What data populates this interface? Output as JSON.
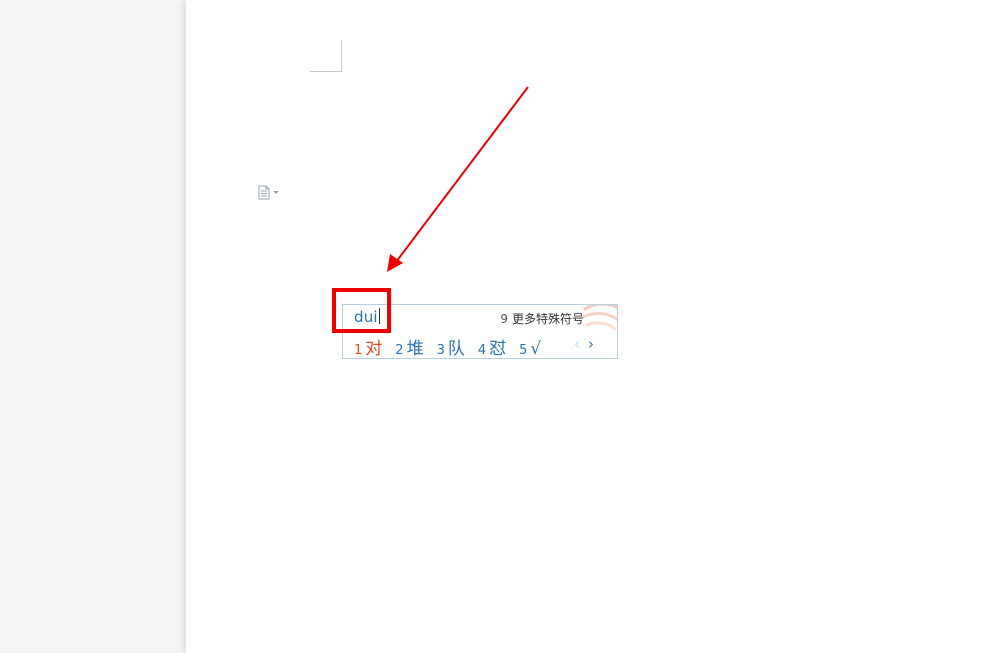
{
  "document": {
    "paragraph_icon": "document-icon",
    "paragraph_dropdown_icon": "caret-down-icon"
  },
  "ime": {
    "composition": "dui",
    "more_symbols_index": "9",
    "more_symbols_label": "更多特殊符号",
    "candidates": [
      {
        "index": "1",
        "text": "对",
        "selected": true
      },
      {
        "index": "2",
        "text": "堆",
        "selected": false
      },
      {
        "index": "3",
        "text": "队",
        "selected": false
      },
      {
        "index": "4",
        "text": "怼",
        "selected": false
      },
      {
        "index": "5",
        "text": "√",
        "selected": false
      }
    ],
    "prev_page_glyph": "‹",
    "next_page_glyph": "›",
    "prev_icon": "chevron-left-icon",
    "next_icon": "chevron-right-icon",
    "decoration_icon": "swirl-logo-icon"
  },
  "annotation": {
    "color": "#ee0000",
    "arrow_icon": "arrow-icon",
    "box": "highlight-box"
  },
  "colors": {
    "candidate_text": "#2a72b8",
    "selected_candidate": "#e34a1b",
    "ime_border": "#b9cfe3"
  }
}
